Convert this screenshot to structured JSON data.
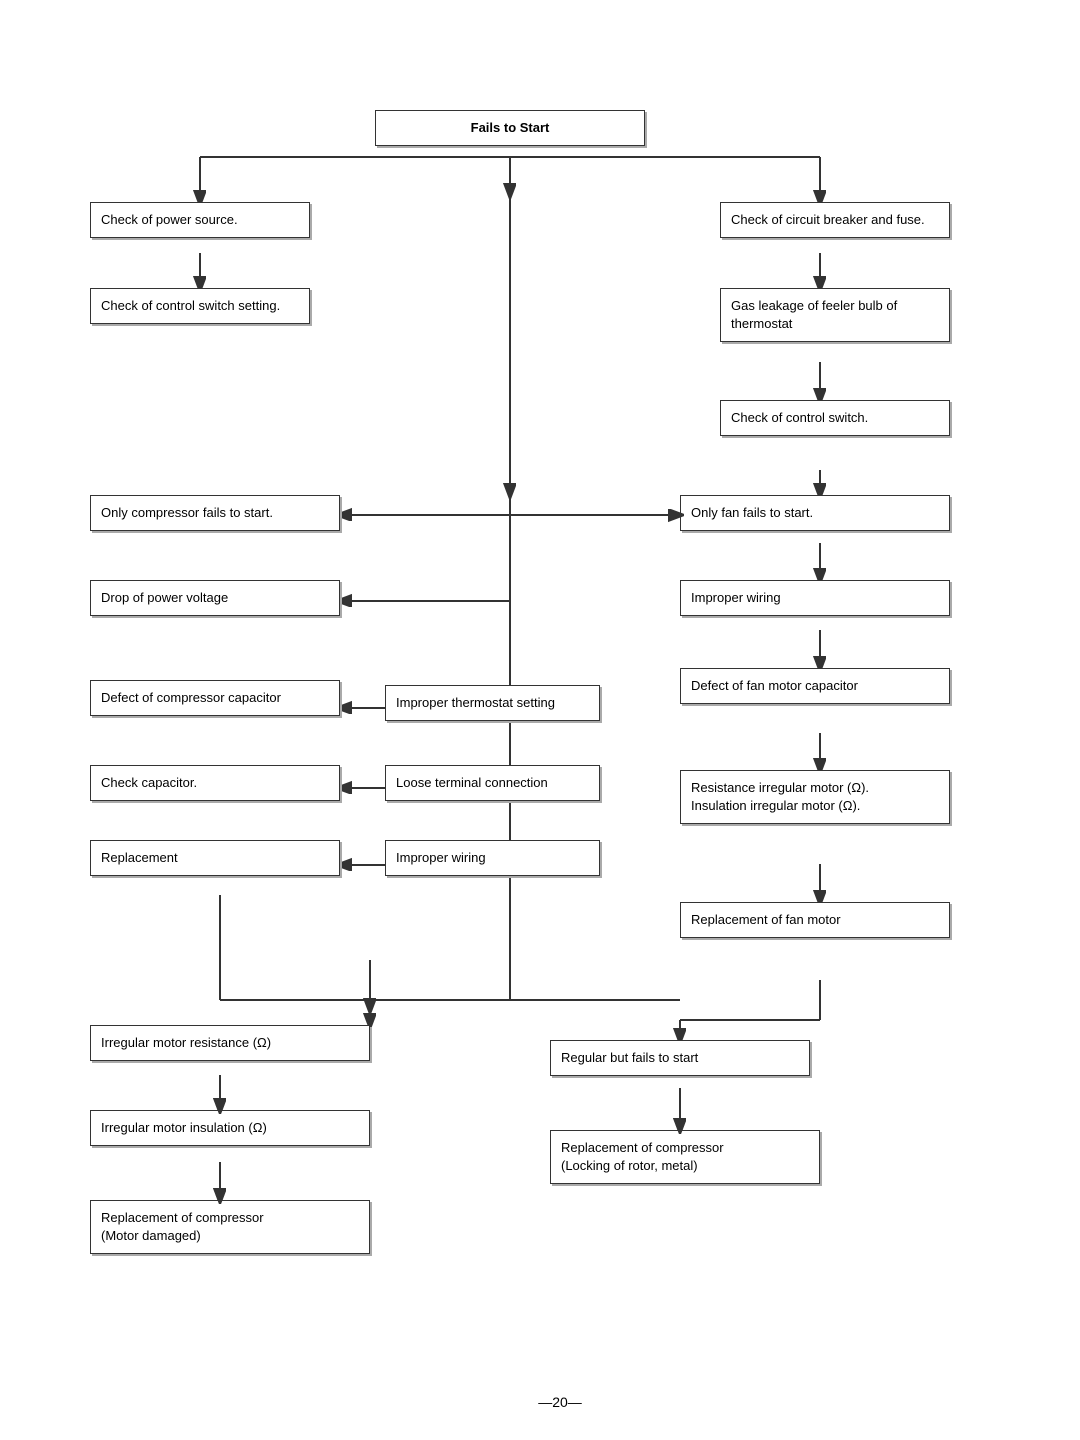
{
  "title": "Fails to Start",
  "boxes": {
    "fails_to_start": "Fails to Start",
    "check_power_source": "Check of power source.",
    "check_control_switch_setting": "Check of control switch setting.",
    "check_circuit_breaker": "Check of circuit breaker and fuse.",
    "gas_leakage": "Gas leakage of feeler bulb of thermostat",
    "check_control_switch": "Check of control switch.",
    "only_compressor_fails": "Only compressor fails to start.",
    "drop_power_voltage": "Drop of power voltage",
    "defect_compressor_cap": "Defect of compressor capacitor",
    "check_capacitor": "Check capacitor.",
    "replacement": "Replacement",
    "only_fan_fails": "Only fan fails to start.",
    "improper_wiring_fan": "Improper wiring",
    "defect_fan_motor_cap": "Defect of fan motor capacitor",
    "resistance_irregular": "Resistance irregular motor (Ω).\nInsulation irregular motor (Ω).",
    "replacement_fan_motor": "Replacement of fan motor",
    "improper_thermostat": "Improper thermostat setting",
    "loose_terminal": "Loose terminal connection",
    "improper_wiring_center": "Improper wiring",
    "irregular_motor_resistance": "Irregular motor resistance (Ω)",
    "irregular_motor_insulation": "Irregular motor insulation (Ω)",
    "replacement_compressor_motor": "Replacement of compressor\n(Motor damaged)",
    "regular_but_fails": "Regular but fails to start",
    "replacement_compressor_locking": "Replacement of compressor\n(Locking of rotor, metal)"
  },
  "page_number": "—20—"
}
